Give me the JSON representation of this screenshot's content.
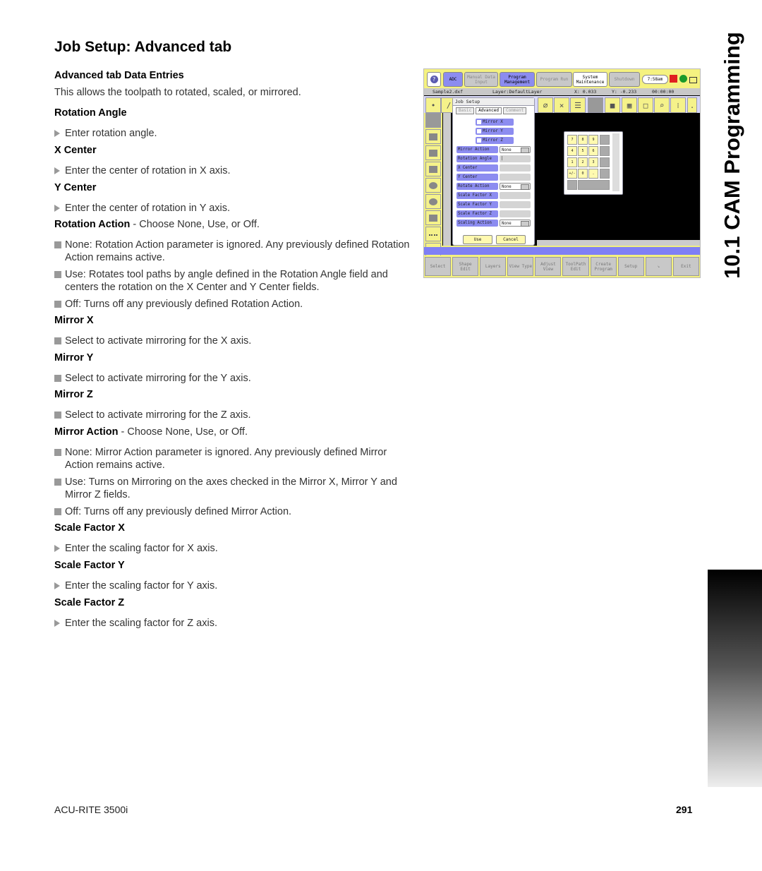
{
  "page": {
    "title": "Job Setup:  Advanced tab",
    "side_title": "10.1 CAM Programming",
    "footer_left": "ACU-RITE 3500i",
    "page_number": "291"
  },
  "content": {
    "intro_heading": "Advanced tab Data Entries",
    "intro_text": "This allows the toolpath to rotated, scaled, or mirrored.",
    "rotation_angle": {
      "heading": "Rotation Angle",
      "step": "Enter rotation angle."
    },
    "x_center": {
      "heading": "X Center",
      "step": "Enter the center of rotation in X axis."
    },
    "y_center": {
      "heading": "Y Center",
      "step": "Enter the center of rotation in Y axis."
    },
    "rotation_action": {
      "label": "Rotation Action",
      "text": " - Choose None, Use, or Off.",
      "bullets": [
        "None: Rotation Action parameter is ignored. Any previously defined Rotation Action remains active.",
        "Use: Rotates tool paths by angle defined in the Rotation Angle field and centers the rotation on the X Center and Y Center fields.",
        "Off: Turns off any previously defined Rotation Action."
      ]
    },
    "mirror_x": {
      "heading": "Mirror X",
      "bullet": "Select to activate mirroring for the X axis."
    },
    "mirror_y": {
      "heading": "Mirror Y",
      "bullet": "Select to activate mirroring for the Y axis."
    },
    "mirror_z": {
      "heading": "Mirror Z",
      "bullet": "Select to activate mirroring for the Z axis."
    },
    "mirror_action": {
      "label": "Mirror Action",
      "text": " - Choose None, Use, or Off.",
      "bullets": [
        "None: Mirror Action parameter is ignored. Any previously defined Mirror Action remains active.",
        "Use: Turns on Mirroring on the axes checked in the Mirror X, Mirror Y and Mirror Z fields.",
        "Off: Turns off any previously defined Mirror Action."
      ]
    },
    "scale_x": {
      "heading": "Scale Factor X",
      "step": "Enter the scaling factor for X axis."
    },
    "scale_y": {
      "heading": "Scale Factor Y",
      "step": "Enter the scaling factor for Y axis."
    },
    "scale_z": {
      "heading": "Scale Factor Z",
      "step": "Enter the scaling factor for Z axis."
    }
  },
  "screenshot": {
    "top_buttons": [
      "?",
      "ADC",
      "Manual Data Input",
      "Program Management",
      "Program Run",
      "System Maintenance",
      "Shutdown"
    ],
    "clock": "7:58am",
    "status": {
      "file": "Sample2.dxf",
      "layer": "Layer:DefaultLayer",
      "x": "X:  0.033",
      "y": "Y:  -0.233",
      "time": "00:00:00"
    },
    "dialog": {
      "title": "Job Setup",
      "tabs": [
        "Basic",
        "Advanced",
        "Comment"
      ],
      "checkboxes": [
        "Mirror X",
        "Mirror Y",
        "Mirror Z"
      ],
      "fields": [
        {
          "label": "Mirror Action",
          "value": "None"
        },
        {
          "label": "Rotation Angle",
          "value": "|"
        },
        {
          "label": "X Center",
          "value": ""
        },
        {
          "label": "Y Center",
          "value": ""
        },
        {
          "label": "Rotate Action",
          "value": "None"
        },
        {
          "label": "Scale Factor X",
          "value": ""
        },
        {
          "label": "Scale Factor Y",
          "value": ""
        },
        {
          "label": "Scale Factor Z",
          "value": ""
        },
        {
          "label": "Scaling Action",
          "value": "None"
        }
      ],
      "use_label": "Use",
      "cancel_label": "Cancel"
    },
    "keypad": [
      "7",
      "8",
      "9",
      "4",
      "5",
      "6",
      "1",
      "2",
      "3",
      "+/-",
      "0",
      "."
    ],
    "softkeys": [
      "Select",
      "Shape Edit",
      "Layers",
      "View Type",
      "Adjust View",
      "ToolPath Edit",
      "Create Program",
      "Setup",
      "",
      "Exit"
    ]
  }
}
